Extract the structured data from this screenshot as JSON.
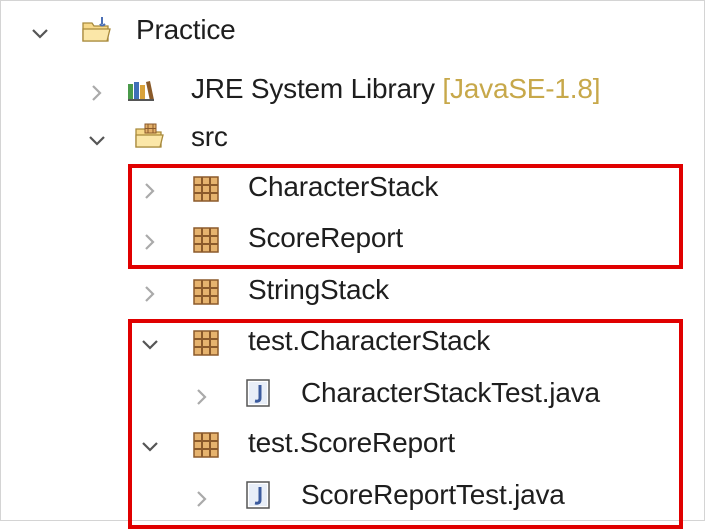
{
  "highlight_color": "#e00000",
  "tree": {
    "project": {
      "label": "Practice",
      "icon": "java-project-folder-icon",
      "expanded": true
    },
    "library": {
      "label": "JRE System Library",
      "decoration": "[JavaSE-1.8]",
      "icon": "library-icon",
      "expanded": false
    },
    "src": {
      "label": "src",
      "icon": "source-folder-icon",
      "expanded": true
    },
    "packages": [
      {
        "label": "CharacterStack",
        "icon": "package-icon",
        "expanded": false
      },
      {
        "label": "ScoreReport",
        "icon": "package-icon",
        "expanded": false
      },
      {
        "label": "StringStack",
        "icon": "package-icon",
        "expanded": false
      },
      {
        "label": "test.CharacterStack",
        "icon": "package-icon",
        "expanded": true,
        "children": [
          {
            "label": "CharacterStackTest.java",
            "icon": "java-file-icon",
            "expanded": false
          }
        ]
      },
      {
        "label": "test.ScoreReport",
        "icon": "package-icon",
        "expanded": true,
        "children": [
          {
            "label": "ScoreReportTest.java",
            "icon": "java-file-icon",
            "expanded": false
          }
        ]
      }
    ]
  }
}
